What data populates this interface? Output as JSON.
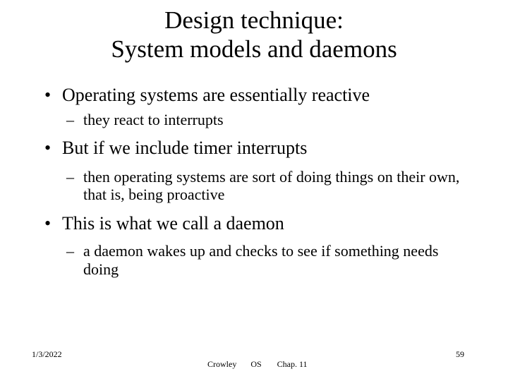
{
  "slide": {
    "background_color": "#ffffff",
    "text_color": "#000000",
    "title": {
      "line1": "Design technique:",
      "line2": "System models and daemons"
    },
    "bullets": [
      {
        "marker": "•",
        "text": "Operating systems are essentially reactive",
        "sub": [
          {
            "marker": "–",
            "text": "they react to interrupts"
          }
        ]
      },
      {
        "marker": "•",
        "text": "But if we include timer interrupts",
        "sub": [
          {
            "marker": "–",
            "text": "then operating systems are sort of doing things on their own, that is, being proactive"
          }
        ]
      },
      {
        "marker": "•",
        "text": "This is what we call a daemon",
        "sub": [
          {
            "marker": "–",
            "text": "a daemon wakes up and checks to see if something needs doing"
          }
        ]
      }
    ],
    "footer": {
      "date": "1/3/2022",
      "author": "Crowley",
      "course": "OS",
      "chapter": "Chap. 11",
      "page_number": "59"
    }
  }
}
